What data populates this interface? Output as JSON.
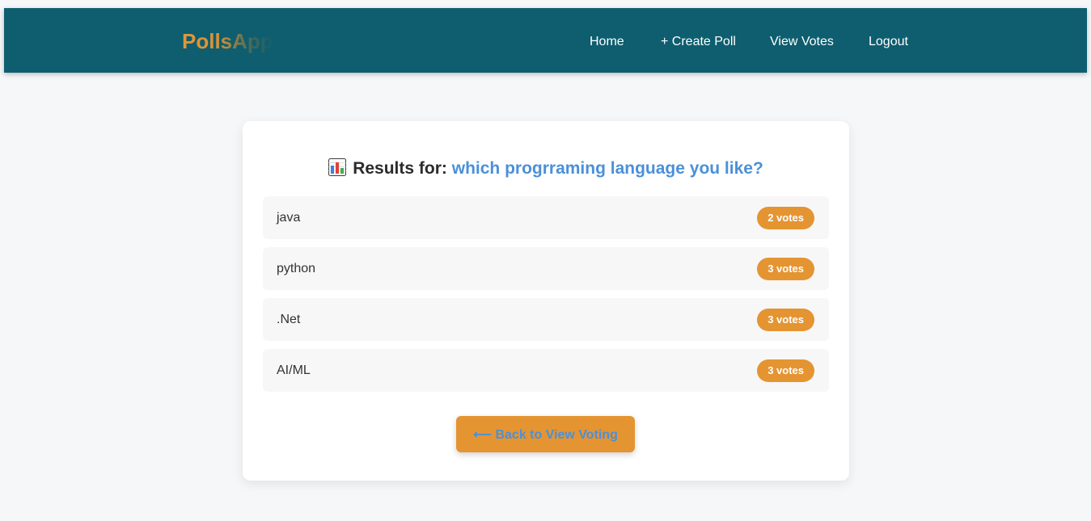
{
  "navbar": {
    "brand": "PollsApp",
    "links": [
      {
        "label": "Home"
      },
      {
        "label": "+ Create Poll"
      },
      {
        "label": "View Votes"
      },
      {
        "label": "Logout"
      }
    ]
  },
  "results": {
    "heading_prefix": "Results for:",
    "question": "which progrraming language you like?",
    "heading_icon": "bar-chart-icon",
    "options": [
      {
        "label": "java",
        "votes": "2 votes"
      },
      {
        "label": "python",
        "votes": "3 votes"
      },
      {
        "label": ".Net",
        "votes": "3 votes"
      },
      {
        "label": "AI/ML",
        "votes": "3 votes"
      }
    ],
    "back_button": "⟵ Back to View Voting"
  },
  "colors": {
    "navbar": "#0e5e6f",
    "accent": "#e59432",
    "question": "#4a90d9",
    "background": "#f6f7f9"
  }
}
